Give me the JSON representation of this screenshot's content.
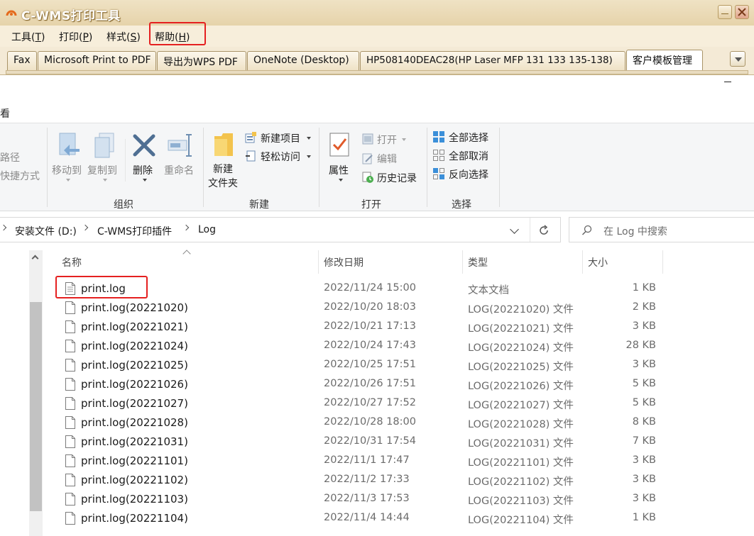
{
  "cwms": {
    "title": "C-WMS打印工具",
    "menu": [
      {
        "label": "工具(",
        "key": "T",
        "end": ")"
      },
      {
        "label": "打印(",
        "key": "P",
        "end": ")"
      },
      {
        "label": "样式(",
        "key": "S",
        "end": ")"
      },
      {
        "label": "帮助(",
        "key": "H",
        "end": ")"
      }
    ],
    "tabs": [
      "Fax",
      "Microsoft Print to PDF",
      "导出为WPS PDF",
      "OneNote (Desktop)",
      "HP508140DEAC28(HP Laser MFP 131 133 135-138)",
      "客户模板管理"
    ],
    "active_tab": "客户模板管理",
    "highlight_color": "#e52020"
  },
  "explorer": {
    "ribbon_tab_fragment": "看",
    "left_fragments": [
      "路径",
      "快捷方式"
    ],
    "organize": {
      "move_to": "移动到",
      "copy_to": "复制到",
      "delete": "删除",
      "rename": "重命名",
      "label": "组织"
    },
    "new": {
      "new_folder_line1": "新建",
      "new_folder_line2": "文件夹",
      "new_item": "新建项目",
      "easy_access": "轻松访问",
      "label": "新建"
    },
    "open": {
      "properties": "属性",
      "open": "打开",
      "edit": "编辑",
      "history": "历史记录",
      "label": "打开"
    },
    "select": {
      "select_all": "全部选择",
      "select_none": "全部取消",
      "invert": "反向选择",
      "label": "选择"
    },
    "address": [
      "安装文件 (D:)",
      "C-WMS打印插件",
      "Log"
    ],
    "search_placeholder": "在 Log 中搜索",
    "columns": {
      "name": "名称",
      "date": "修改日期",
      "type": "类型",
      "size": "大小"
    },
    "files": [
      {
        "name": "print.log",
        "date": "2022/11/24 15:00",
        "type": "文本文档",
        "size": "1 KB"
      },
      {
        "name": "print.log(20221020)",
        "date": "2022/10/20 18:03",
        "type": "LOG(20221020) 文件",
        "size": "2 KB"
      },
      {
        "name": "print.log(20221021)",
        "date": "2022/10/21 17:13",
        "type": "LOG(20221021) 文件",
        "size": "3 KB"
      },
      {
        "name": "print.log(20221024)",
        "date": "2022/10/24 17:43",
        "type": "LOG(20221024) 文件",
        "size": "28 KB"
      },
      {
        "name": "print.log(20221025)",
        "date": "2022/10/25 17:51",
        "type": "LOG(20221025) 文件",
        "size": "3 KB"
      },
      {
        "name": "print.log(20221026)",
        "date": "2022/10/26 17:51",
        "type": "LOG(20221026) 文件",
        "size": "5 KB"
      },
      {
        "name": "print.log(20221027)",
        "date": "2022/10/27 17:52",
        "type": "LOG(20221027) 文件",
        "size": "5 KB"
      },
      {
        "name": "print.log(20221028)",
        "date": "2022/10/28 18:00",
        "type": "LOG(20221028) 文件",
        "size": "8 KB"
      },
      {
        "name": "print.log(20221031)",
        "date": "2022/10/31 17:54",
        "type": "LOG(20221031) 文件",
        "size": "7 KB"
      },
      {
        "name": "print.log(20221101)",
        "date": "2022/11/1 17:47",
        "type": "LOG(20221101) 文件",
        "size": "3 KB"
      },
      {
        "name": "print.log(20221102)",
        "date": "2022/11/2 17:33",
        "type": "LOG(20221102) 文件",
        "size": "3 KB"
      },
      {
        "name": "print.log(20221103)",
        "date": "2022/11/3 17:53",
        "type": "LOG(20221103) 文件",
        "size": "3 KB"
      },
      {
        "name": "print.log(20221104)",
        "date": "2022/11/4 14:44",
        "type": "LOG(20221104) 文件",
        "size": "1 KB"
      }
    ]
  }
}
